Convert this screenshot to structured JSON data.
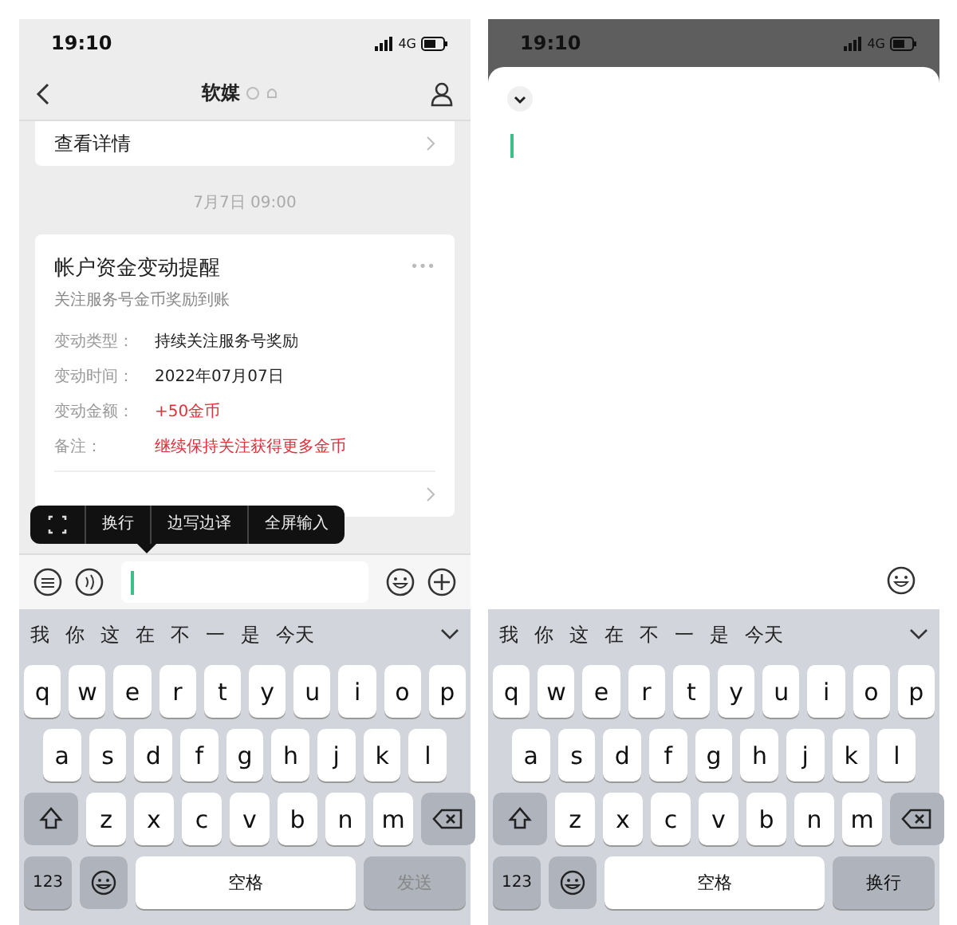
{
  "phones": [
    {
      "kind": "chat",
      "status": {
        "time": "19:10",
        "network": "4G"
      },
      "nav": {
        "title": "软媒"
      },
      "top_card": {
        "link": "查看详情"
      },
      "timestamp": "7月7日 09:00",
      "notice": {
        "title": "帐户资金变动提醒",
        "subtitle": "关注服务号金币奖励到账",
        "more": "•••",
        "rows": [
          {
            "label": "变动类型：",
            "value": "持续关注服务号奖励",
            "highlight": false
          },
          {
            "label": "变动时间：",
            "value": "2022年07月07日",
            "highlight": false
          },
          {
            "label": "变动金额：",
            "value": "+50金币",
            "highlight": true
          },
          {
            "label": "备注：",
            "value": "继续保持关注获得更多金币",
            "highlight": true
          }
        ]
      },
      "popup": {
        "items": [
          "换行",
          "边写边译",
          "全屏输入"
        ]
      },
      "keyboard": {
        "candidates": [
          "我",
          "你",
          "这",
          "在",
          "不",
          "一",
          "是",
          "今天"
        ],
        "rows": [
          [
            "q",
            "w",
            "e",
            "r",
            "t",
            "y",
            "u",
            "i",
            "o",
            "p"
          ],
          [
            "a",
            "s",
            "d",
            "f",
            "g",
            "h",
            "j",
            "k",
            "l"
          ],
          [
            "z",
            "x",
            "c",
            "v",
            "b",
            "n",
            "m"
          ]
        ],
        "number_key": "123",
        "space": "空格",
        "action": {
          "label": "发送",
          "disabled": true
        }
      }
    },
    {
      "kind": "fullscreen",
      "status": {
        "time": "19:10",
        "network": "4G"
      },
      "keyboard": {
        "candidates": [
          "我",
          "你",
          "这",
          "在",
          "不",
          "一",
          "是",
          "今天"
        ],
        "rows": [
          [
            "q",
            "w",
            "e",
            "r",
            "t",
            "y",
            "u",
            "i",
            "o",
            "p"
          ],
          [
            "a",
            "s",
            "d",
            "f",
            "g",
            "h",
            "j",
            "k",
            "l"
          ],
          [
            "z",
            "x",
            "c",
            "v",
            "b",
            "n",
            "m"
          ]
        ],
        "number_key": "123",
        "space": "空格",
        "action": {
          "label": "换行",
          "disabled": false
        }
      }
    }
  ]
}
